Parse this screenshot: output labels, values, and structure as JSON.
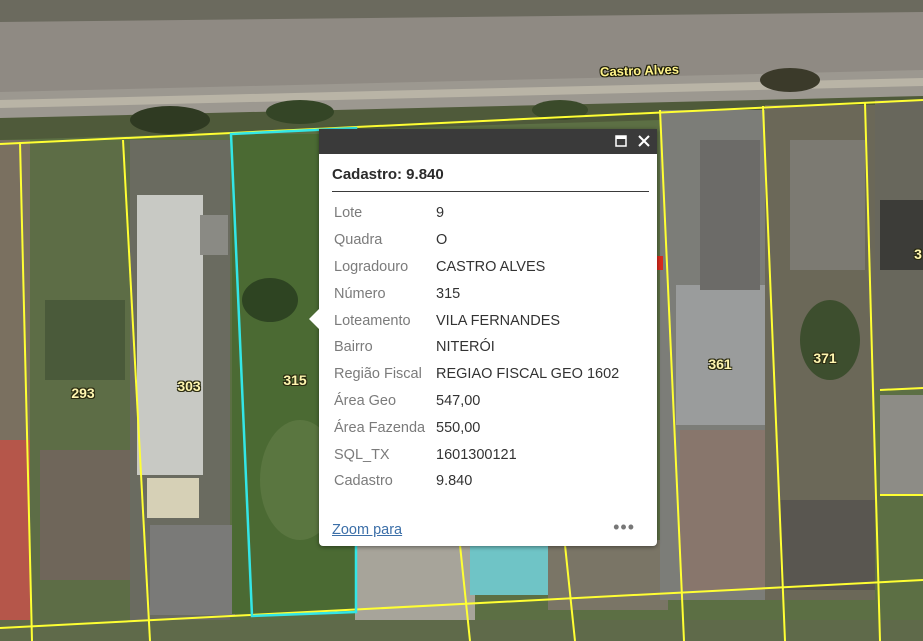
{
  "map": {
    "street_name": "Castro Alves",
    "parcel_numbers": [
      "293",
      "303",
      "315",
      "361",
      "371",
      "3"
    ],
    "colors": {
      "parcel_line": "#ffff33",
      "selected_outline": "#33e6e6",
      "road": "#8f8a83"
    }
  },
  "popup": {
    "title": "Cadastro: 9.840",
    "fields": [
      {
        "label": "Lote",
        "value": "9"
      },
      {
        "label": "Quadra",
        "value": "O"
      },
      {
        "label": "Logradouro",
        "value": "CASTRO ALVES"
      },
      {
        "label": "Número",
        "value": "315"
      },
      {
        "label": "Loteamento",
        "value": "VILA FERNANDES"
      },
      {
        "label": "Bairro",
        "value": "NITERÓI"
      },
      {
        "label": "Região Fiscal",
        "value": "REGIAO FISCAL GEO 1602"
      },
      {
        "label": "Área Geo",
        "value": "547,00"
      },
      {
        "label": "Área Fazenda",
        "value": "550,00"
      },
      {
        "label": "SQL_TX",
        "value": "1601300121"
      },
      {
        "label": "Cadastro",
        "value": "9.840"
      }
    ],
    "zoom_label": "Zoom para",
    "more_label": "•••",
    "icons": [
      "maximize-icon",
      "close-icon",
      "more-icon"
    ]
  }
}
